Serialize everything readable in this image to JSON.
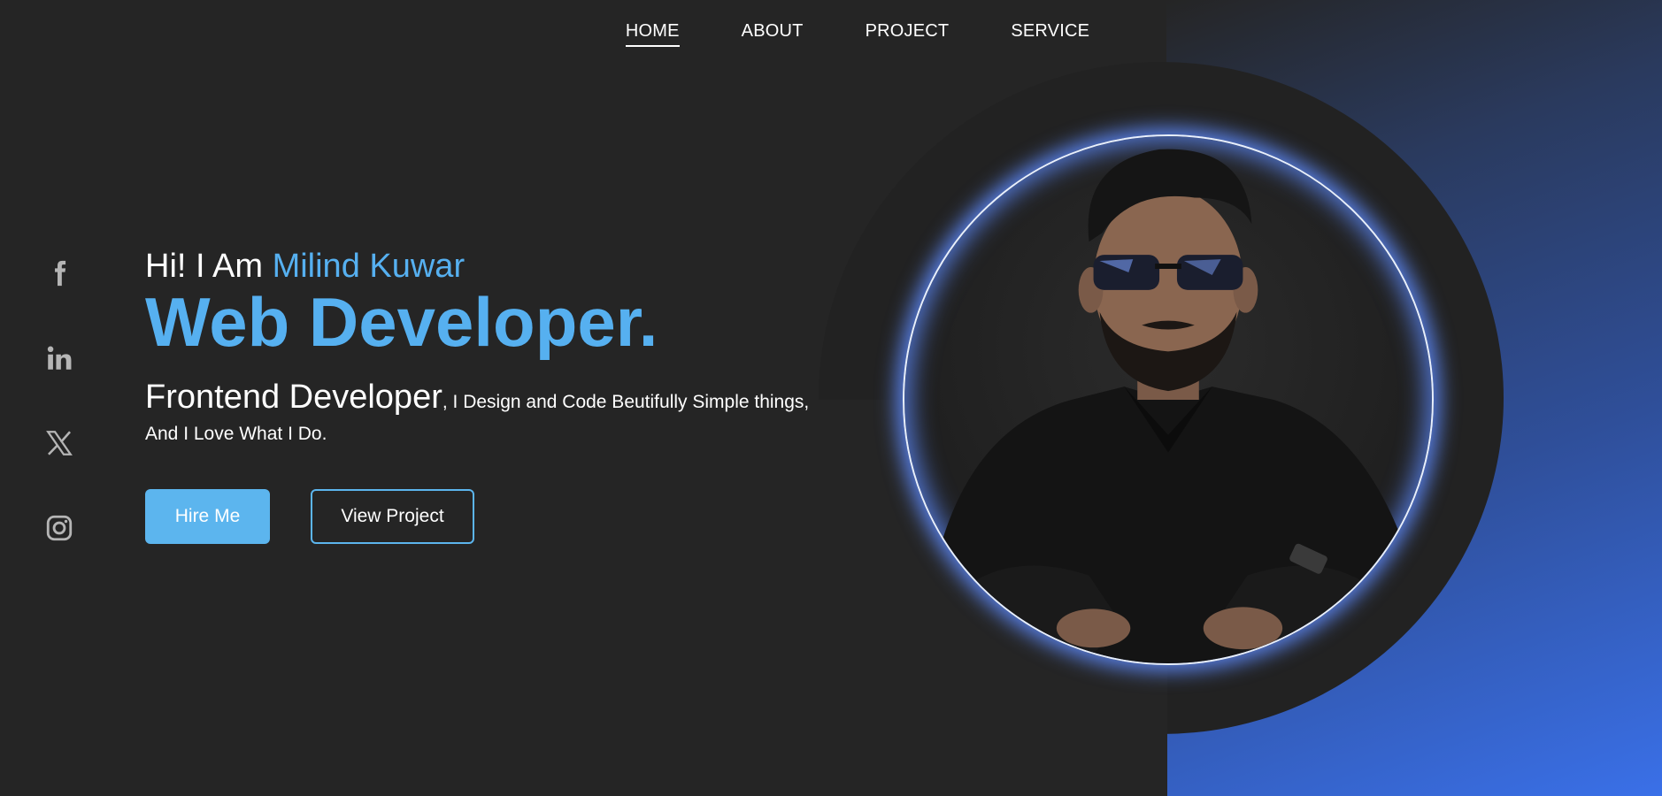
{
  "nav": {
    "items": [
      {
        "label": "HOME",
        "active": true
      },
      {
        "label": "ABOUT",
        "active": false
      },
      {
        "label": "PROJECT",
        "active": false
      },
      {
        "label": "SERVICE",
        "active": false
      }
    ]
  },
  "socials": [
    {
      "icon": "facebook-icon"
    },
    {
      "icon": "linkedin-icon"
    },
    {
      "icon": "x-twitter-icon"
    },
    {
      "icon": "instagram-icon"
    }
  ],
  "hero": {
    "greeting": "Hi! I Am ",
    "name": "Milind Kuwar",
    "title": "Web Developer.",
    "role": "Frontend Developer",
    "description": ", I Design and Code Beutifully Simple things, And I Love What I Do.",
    "hire_label": "Hire Me",
    "project_label": "View Project"
  },
  "colors": {
    "accent": "#56b0f0",
    "background": "#252525",
    "glow": "#5f8cff",
    "gradient_end": "#3a70e8"
  }
}
